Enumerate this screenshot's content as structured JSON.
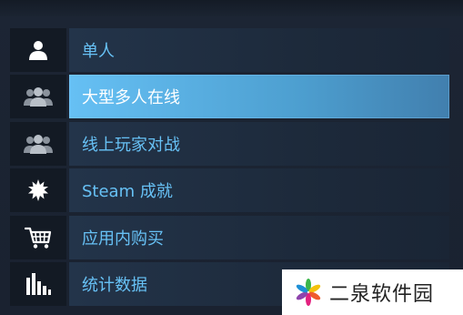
{
  "menu": {
    "items": [
      {
        "label": "单人",
        "icon": "single-player-icon",
        "active": false
      },
      {
        "label": "大型多人在线",
        "icon": "multi-player-icon",
        "active": true
      },
      {
        "label": "线上玩家对战",
        "icon": "multi-player-icon",
        "active": false
      },
      {
        "label": "Steam 成就",
        "icon": "achievement-icon",
        "active": false
      },
      {
        "label": "应用内购买",
        "icon": "cart-icon",
        "active": false
      },
      {
        "label": "统计数据",
        "icon": "stats-icon",
        "active": false
      }
    ]
  },
  "watermark": {
    "text": "二泉软件园",
    "logo": "pinwheel-logo"
  },
  "colors": {
    "label": "#67c1f5",
    "active_bg": "#66c0f4",
    "icon_cell": "#131a24",
    "label_cell": "#23344a"
  }
}
